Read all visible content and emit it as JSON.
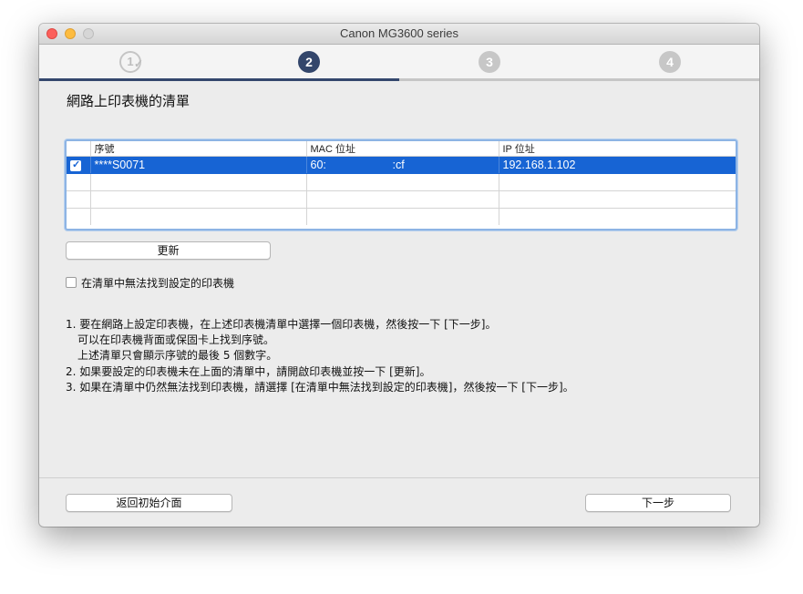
{
  "window": {
    "title": "Canon MG3600 series"
  },
  "steps": [
    {
      "label": "1",
      "state": "done"
    },
    {
      "label": "2",
      "state": "active"
    },
    {
      "label": "3",
      "state": "future"
    },
    {
      "label": "4",
      "state": "future"
    }
  ],
  "heading": "網路上印表機的清單",
  "table": {
    "columns": [
      "",
      "序號",
      "MAC 位址",
      "IP 位址"
    ],
    "rows": [
      {
        "checked": true,
        "serial": "****S0071",
        "mac_prefix": "60:",
        "mac_suffix": ":cf",
        "ip": "192.168.1.102"
      }
    ]
  },
  "refresh_button": "更新",
  "not_found_checkbox": {
    "label": "在清單中無法找到設定的印表機",
    "checked": false
  },
  "instructions": [
    "1. 要在網路上設定印表機，在上述印表機清單中選擇一個印表機，然後按一下 [下一步]。",
    "可以在印表機背面或保固卡上找到序號。",
    "上述清單只會顯示序號的最後 5 個數字。",
    "2. 如果要設定的印表機未在上面的清單中，請開啟印表機並按一下 [更新]。",
    "3. 如果在清單中仍然無法找到印表機，請選擇 [在清單中無法找到設定的印表機]，然後按一下 [下一步]。"
  ],
  "footer": {
    "back_label": "返回初始介面",
    "next_label": "下一步"
  },
  "colors": {
    "accent": "#33466b",
    "selection": "#1764d4"
  },
  "progress": 0.5
}
